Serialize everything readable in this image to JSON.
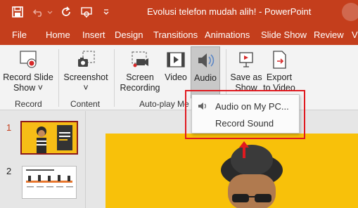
{
  "window": {
    "title": "Evolusi telefon mudah alih! - PowerPoint"
  },
  "quick_access": {
    "save_icon": "save-icon",
    "undo_icon": "undo-icon",
    "redo_icon": "redo-icon",
    "presenter_icon": "present-from-start-icon",
    "customize_icon": "customize-qat-icon"
  },
  "menu": {
    "tabs": [
      "File",
      "Home",
      "Insert",
      "Design",
      "Transitions",
      "Animations",
      "Slide Show",
      "Review",
      "V"
    ]
  },
  "ribbon": {
    "record_slide_show": {
      "line1": "Record Slide",
      "line2": "Show ˅"
    },
    "screenshot": {
      "line1": "Screenshot",
      "line2": "˅"
    },
    "screen_recording": {
      "line1": "Screen",
      "line2": "Recording"
    },
    "video": {
      "line1": "Video"
    },
    "audio": {
      "line1": "Audio"
    },
    "save_as_show": {
      "line1": "Save as",
      "line2": "Show"
    },
    "export_to_video": {
      "line1": "Export",
      "line2": "to Video"
    },
    "groups": {
      "record": "Record",
      "content": "Content",
      "autoplay": "Auto-play Me"
    }
  },
  "audio_menu": {
    "items": [
      {
        "label": "Audio on My PC..."
      },
      {
        "label": "Record Sound"
      }
    ]
  },
  "slides": {
    "numbers": [
      "1",
      "2"
    ]
  },
  "colors": {
    "accent": "#c43e1c",
    "annotation": "#e0191f",
    "slide_bg": "#f8c10a"
  }
}
